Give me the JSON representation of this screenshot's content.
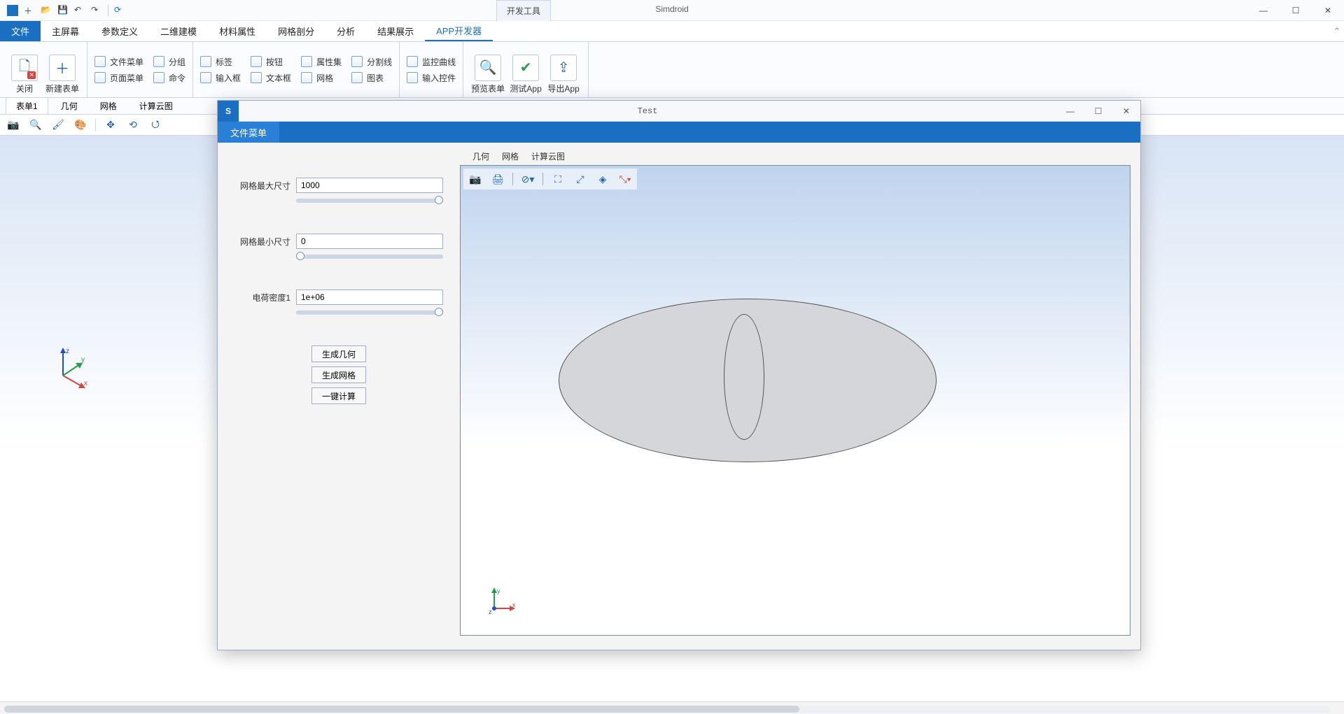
{
  "app": {
    "title": "Simdroid",
    "devToolsTab": "开发工具"
  },
  "ribbonTabs": {
    "file": "文件",
    "items": [
      "主屏幕",
      "参数定义",
      "二维建模",
      "材料属性",
      "网格剖分",
      "分析",
      "结果展示",
      "APP开发器"
    ]
  },
  "ribbon": {
    "close": "关闭",
    "newForm": "新建表单",
    "col1": {
      "a": "文件菜单",
      "b": "页面菜单"
    },
    "col2": {
      "a": "分组",
      "b": "命令"
    },
    "col3": {
      "a": "标签",
      "b": "输入框"
    },
    "col4": {
      "a": "按钮",
      "b": "文本框"
    },
    "col5": {
      "a": "属性集",
      "b": "网格"
    },
    "col6": {
      "a": "分割线",
      "b": "图表"
    },
    "col7": {
      "a": "监控曲线",
      "b": "输入控件"
    },
    "big": {
      "preview": "预览表单",
      "test": "测试App",
      "export": "导出App"
    }
  },
  "docTabs": [
    "表单1",
    "几何",
    "网格",
    "计算云图"
  ],
  "dialog": {
    "title": "Test",
    "menu": "文件菜单",
    "params": {
      "maxSize": {
        "label": "网格最大尺寸",
        "value": "1000"
      },
      "minSize": {
        "label": "网格最小尺寸",
        "value": "0"
      },
      "chargeDensity": {
        "label": "电荷密度1",
        "value": "1e+06"
      }
    },
    "buttons": {
      "genGeom": "生成几何",
      "genMesh": "生成网格",
      "compute": "一键计算"
    },
    "viewTabs": [
      "几何",
      "网格",
      "计算云图"
    ]
  },
  "axis": {
    "x": "x",
    "y": "y",
    "z": "z"
  }
}
